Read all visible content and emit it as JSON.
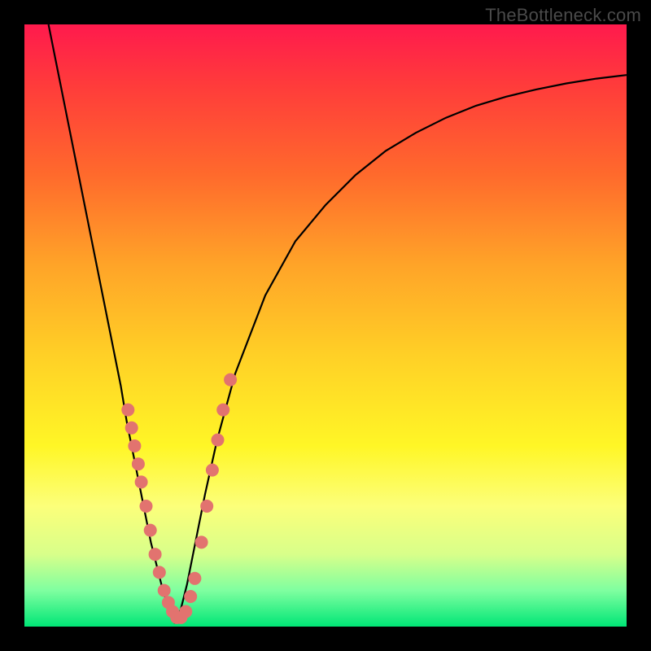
{
  "watermark": "TheBottleneck.com",
  "chart_data": {
    "type": "line",
    "title": "",
    "xlabel": "",
    "ylabel": "",
    "xlim": [
      0,
      100
    ],
    "ylim": [
      0,
      100
    ],
    "series": [
      {
        "name": "left-branch",
        "x": [
          4,
          6,
          8,
          10,
          12,
          14,
          16,
          17,
          18,
          19,
          20,
          21,
          22,
          23,
          24,
          25
        ],
        "y": [
          100,
          90,
          80,
          70,
          60,
          50,
          40,
          34,
          29,
          24,
          19,
          14,
          10,
          6,
          3,
          0.5
        ]
      },
      {
        "name": "right-branch",
        "x": [
          25,
          26,
          27,
          28,
          29,
          30,
          32,
          35,
          40,
          45,
          50,
          55,
          60,
          65,
          70,
          75,
          80,
          85,
          90,
          95,
          100
        ],
        "y": [
          0.5,
          3,
          7,
          12,
          17,
          22,
          31,
          42,
          55,
          64,
          70,
          75,
          79,
          82,
          84.5,
          86.5,
          88,
          89.2,
          90.2,
          91,
          91.6
        ]
      }
    ],
    "scatter": [
      {
        "x": 17.2,
        "y": 36
      },
      {
        "x": 17.8,
        "y": 33
      },
      {
        "x": 18.3,
        "y": 30
      },
      {
        "x": 18.9,
        "y": 27
      },
      {
        "x": 19.4,
        "y": 24
      },
      {
        "x": 20.2,
        "y": 20
      },
      {
        "x": 20.9,
        "y": 16
      },
      {
        "x": 21.7,
        "y": 12
      },
      {
        "x": 22.4,
        "y": 9
      },
      {
        "x": 23.2,
        "y": 6
      },
      {
        "x": 23.9,
        "y": 4
      },
      {
        "x": 24.6,
        "y": 2.5
      },
      {
        "x": 25.3,
        "y": 1.5
      },
      {
        "x": 26.0,
        "y": 1.5
      },
      {
        "x": 26.8,
        "y": 2.5
      },
      {
        "x": 27.6,
        "y": 5
      },
      {
        "x": 28.3,
        "y": 8
      },
      {
        "x": 29.4,
        "y": 14
      },
      {
        "x": 30.3,
        "y": 20
      },
      {
        "x": 31.2,
        "y": 26
      },
      {
        "x": 32.1,
        "y": 31
      },
      {
        "x": 33.0,
        "y": 36
      },
      {
        "x": 34.2,
        "y": 41
      }
    ],
    "scatter_color": "#e2736f",
    "scatter_radius": 8
  }
}
